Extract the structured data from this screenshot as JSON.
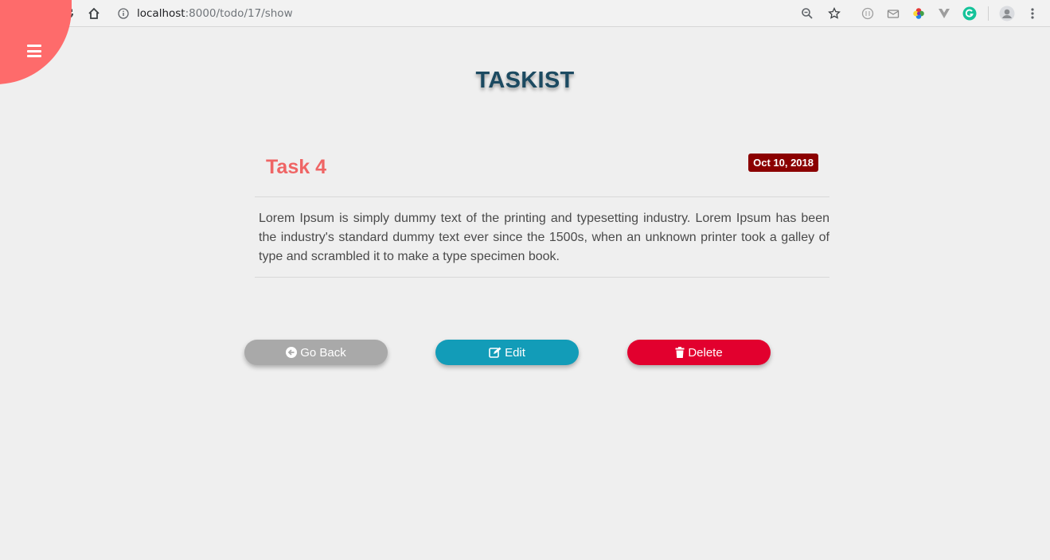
{
  "browser": {
    "url_host": "localhost",
    "url_path": ":8000/todo/17/show"
  },
  "app": {
    "title": "TASKIST"
  },
  "task": {
    "title": "Task 4",
    "date": "Oct 10, 2018",
    "body": "Lorem Ipsum is simply dummy text of the printing and typesetting industry. Lorem Ipsum has been the industry's standard dummy text ever since the 1500s, when an unknown printer took a galley of type and scrambled it to make a type specimen book."
  },
  "actions": {
    "back_label": "Go Back",
    "edit_label": "Edit",
    "delete_label": "Delete"
  },
  "colors": {
    "accent": "#fe6b6b",
    "title": "#1c4a61",
    "task_title": "#ef6565",
    "date_badge": "#8b0000",
    "back_button": "#a9a9a9",
    "edit_button": "#129cb8",
    "delete_button": "#e2002e"
  }
}
